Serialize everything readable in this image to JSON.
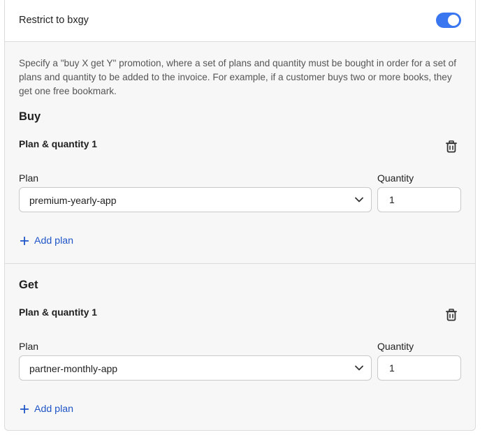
{
  "header": {
    "title": "Restrict to bxgy",
    "toggle_on": true,
    "toggle_color": "#3a76f0"
  },
  "description": "Specify a \"buy X get Y\" promotion, where a set of plans and quantity must be bought in order for a set of plans and quantity to be added to the invoice. For example, if a customer buys two or more books, they get one free bookmark.",
  "buy": {
    "title": "Buy",
    "group_title": "Plan & quantity 1",
    "plan_label": "Plan",
    "plan_value": "premium-yearly-app",
    "quantity_label": "Quantity",
    "quantity_value": "1",
    "add_plan_label": "Add plan"
  },
  "get": {
    "title": "Get",
    "group_title": "Plan & quantity 1",
    "plan_label": "Plan",
    "plan_value": "partner-monthly-app",
    "quantity_label": "Quantity",
    "quantity_value": "1",
    "add_plan_label": "Add plan"
  },
  "icons": {
    "delete": "trash-icon",
    "dropdown": "chevron-down-icon",
    "add": "plus-icon"
  },
  "colors": {
    "accent": "#3a76f0",
    "link": "#1f55c8"
  }
}
